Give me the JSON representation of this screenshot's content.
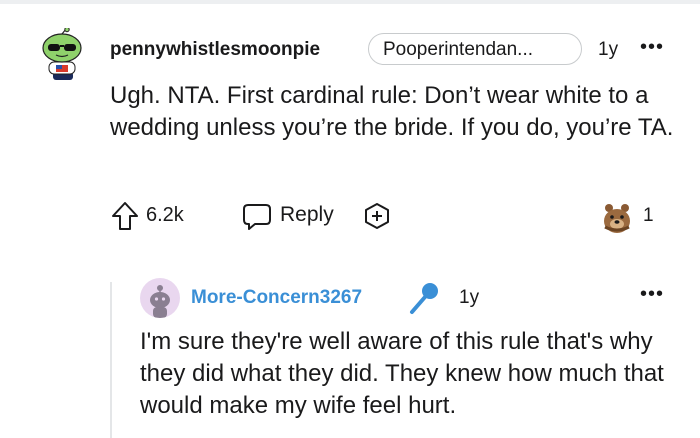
{
  "comment": {
    "username": "pennywhistlesmoonpie",
    "flair": "Pooperintendan...",
    "time": "1y",
    "more_label": "•••",
    "body": "Ugh. NTA. First cardinal rule: Don’t wear white to a wedding unless you’re the bride. If you do, you’re TA.",
    "upvotes": "6.2k",
    "reply_label": "Reply",
    "award_count": "1",
    "icons": [
      "upvote-icon",
      "reply-icon",
      "add-award-icon",
      "bear-award-icon"
    ]
  },
  "reply": {
    "username": "More-Concern3267",
    "time": "1y",
    "more_label": "•••",
    "body": "I'm sure they're well aware of this rule that's why they did what they did. They knew how much that would make my wife feel hurt.",
    "icons": [
      "op-microphone-icon"
    ]
  },
  "colors": {
    "reply_username": "#3a8fd6",
    "avatar2_bg": "#e9d7ef"
  }
}
